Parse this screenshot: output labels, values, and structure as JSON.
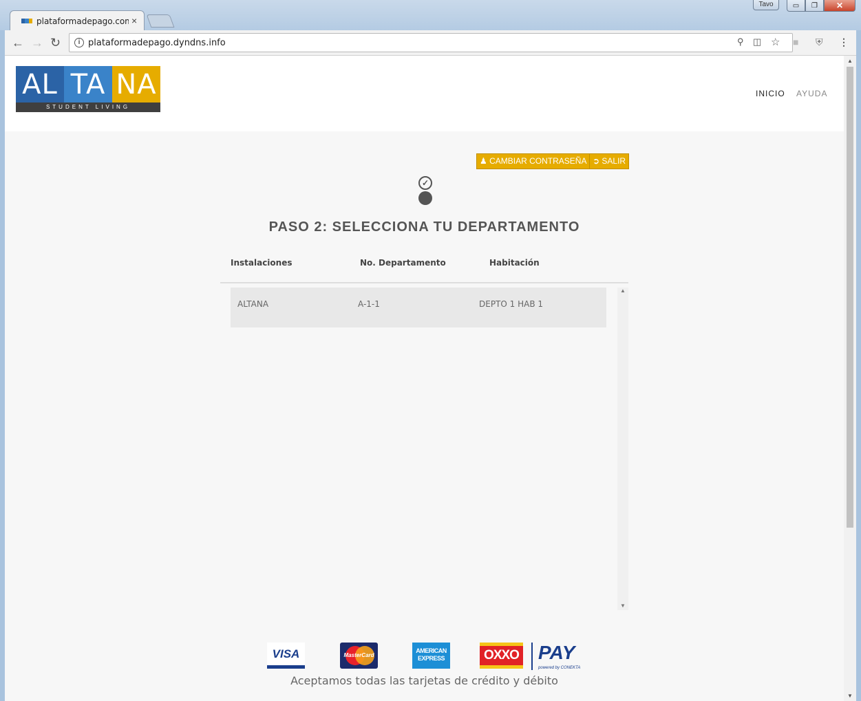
{
  "window": {
    "user": "Tavo",
    "minimize": "▭",
    "restore": "❐",
    "close": "✕"
  },
  "browser": {
    "tab_title": "plataformadepago.com.mx",
    "tab_close": "×",
    "url": "plataformadepago.dyndns.info",
    "info": "i",
    "icons": [
      "back-icon",
      "forward-icon",
      "reload-icon",
      "key-icon",
      "translate-icon",
      "star-icon",
      "pdf-icon",
      "shield-icon",
      "menu-icon"
    ]
  },
  "brand": {
    "logo_segments": [
      "AL",
      "TA",
      "NA"
    ],
    "logo_colors": [
      "#2b63a6",
      "#3a83c9",
      "#e6ac00"
    ],
    "logo_tagline": "STUDENT LIVING"
  },
  "nav": {
    "items": [
      "INICIO",
      "AYUDA"
    ]
  },
  "actions": {
    "change_password": "CAMBIAR CONTRASEÑA",
    "logout": "SALIR"
  },
  "steps": {
    "completed_icon": "✓",
    "heading": "PASO 2: SELECCIONA TU DEPARTAMENTO"
  },
  "table": {
    "columns": [
      "Instalaciones",
      "No. Departamento",
      "Habitación"
    ],
    "rows": [
      {
        "instalaciones": "ALTANA",
        "departamento": "A-1-1",
        "habitacion": "DEPTO 1 HAB 1"
      }
    ]
  },
  "payments": {
    "visa": "VISA",
    "mastercard": "MasterCard",
    "amex": "AMERICAN EXPRESS",
    "oxxo": "OXXO",
    "pay": "PAY",
    "powered": "powered by CONEKTA",
    "caption": "Aceptamos todas las tarjetas de crédito y débito"
  },
  "colors": {
    "accent_yellow": "#e6ac00",
    "page_bg": "#f7f7f7",
    "row_bg": "#e8e8e8"
  }
}
